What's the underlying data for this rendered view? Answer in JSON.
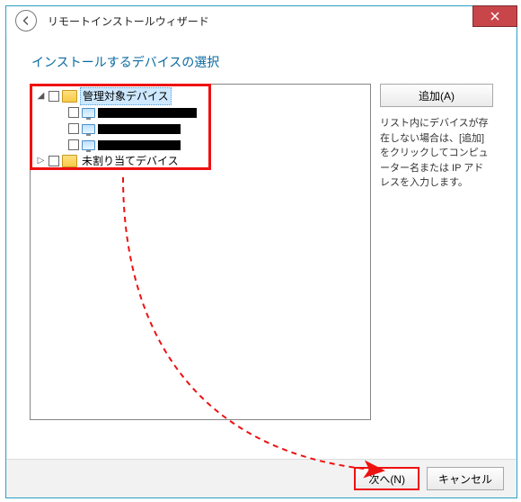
{
  "window": {
    "title": "リモートインストールウィザード"
  },
  "heading": "インストールするデバイスの選択",
  "tree": {
    "managed_label": "管理対象デバイス",
    "unassigned_label": "未割り当てデバイス"
  },
  "side": {
    "add_button": "追加(A)",
    "help_text": "リスト内にデバイスが存在しない場合は、[追加] をクリックしてコンピューター名または IP アドレスを入力します。"
  },
  "footer": {
    "next": "次へ(N)",
    "cancel": "キャンセル"
  }
}
